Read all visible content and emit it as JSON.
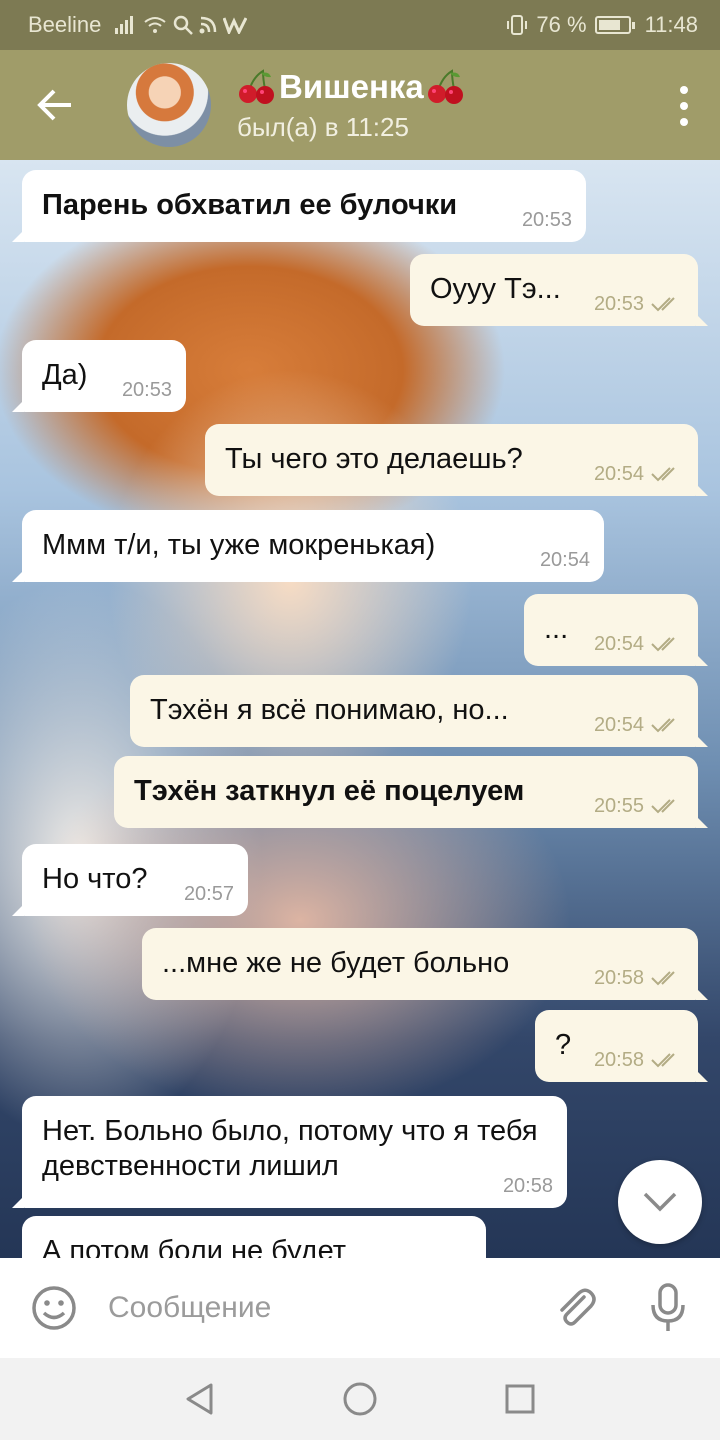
{
  "status_bar": {
    "carrier": "Beeline",
    "battery_percent": "76 %",
    "battery_level": 0.76,
    "time": "11:48"
  },
  "header": {
    "contact_name": "Вишенка",
    "last_seen": "был(а) в 11:25",
    "accent_color": "#a09c69"
  },
  "messages": [
    {
      "direction": "in",
      "text": "Парень обхватил ее булочки",
      "bold": true,
      "time": "20:53"
    },
    {
      "direction": "out",
      "text": "Оууу Тэ...",
      "bold": false,
      "time": "20:53",
      "read": true
    },
    {
      "direction": "in",
      "text": "Да)",
      "bold": false,
      "time": "20:53"
    },
    {
      "direction": "out",
      "text": "Ты чего это делаешь?",
      "bold": false,
      "time": "20:54",
      "read": true
    },
    {
      "direction": "in",
      "text": "Ммм т/и, ты уже мокренькая)",
      "bold": false,
      "time": "20:54"
    },
    {
      "direction": "out",
      "text": "...",
      "bold": false,
      "time": "20:54",
      "read": true
    },
    {
      "direction": "out",
      "text": "Тэхён я всё понимаю, но...",
      "bold": false,
      "time": "20:54",
      "read": true
    },
    {
      "direction": "out",
      "text": "Тэхён заткнул её поцелуем",
      "bold": true,
      "time": "20:55",
      "read": true
    },
    {
      "direction": "in",
      "text": "Но что?",
      "bold": false,
      "time": "20:57"
    },
    {
      "direction": "out",
      "text": "...мне же не будет больно",
      "bold": false,
      "time": "20:58",
      "read": true
    },
    {
      "direction": "out",
      "text": "?",
      "bold": false,
      "time": "20:58",
      "read": true
    },
    {
      "direction": "in",
      "text": "Нет. Больно было, потому что я тебя девственности лишил",
      "bold": false,
      "time": "20:58"
    },
    {
      "direction": "in",
      "text": "А потом боли не будет",
      "bold": false,
      "time": ""
    }
  ],
  "input": {
    "placeholder": "Сообщение"
  },
  "icons": {
    "back": "arrow-left-icon",
    "menu": "more-vert-icon",
    "emoji": "smile-icon",
    "attach": "paperclip-icon",
    "mic": "microphone-icon",
    "scroll_down": "chevron-down-icon",
    "nav_back": "triangle-back-icon",
    "nav_home": "circle-home-icon",
    "nav_recent": "square-recent-icon"
  }
}
